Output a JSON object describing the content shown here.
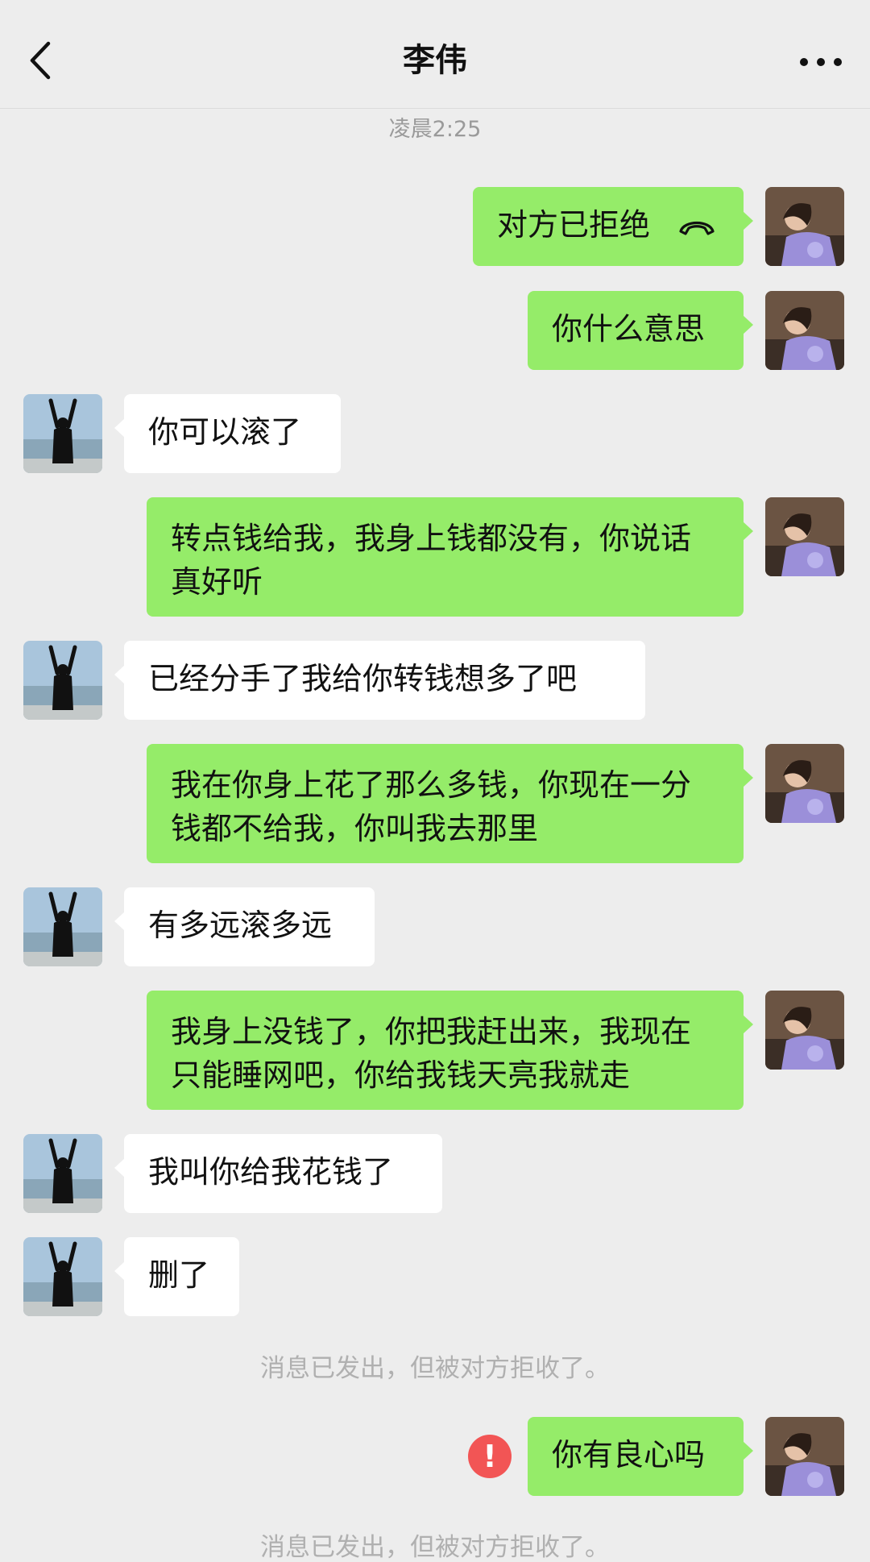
{
  "header": {
    "title": "李伟",
    "back_icon": "chevron-left-icon",
    "more_icon": "ellipsis-icon"
  },
  "chat": {
    "timestamp": "凌晨2:25",
    "messages": [
      {
        "from": "me",
        "text": "对方已拒绝",
        "icon": "phone-hangup-icon"
      },
      {
        "from": "me",
        "text": "你什么意思"
      },
      {
        "from": "other",
        "text": "你可以滚了"
      },
      {
        "from": "me",
        "text": "转点钱给我，我身上钱都没有，你说话真好听"
      },
      {
        "from": "other",
        "text": "已经分手了我给你转钱想多了吧"
      },
      {
        "from": "me",
        "text": "我在你身上花了那么多钱，你现在一分钱都不给我，你叫我去那里"
      },
      {
        "from": "other",
        "text": "有多远滚多远"
      },
      {
        "from": "me",
        "text": "我身上没钱了，你把我赶出来，我现在只能睡网吧，你给我钱天亮我就走"
      },
      {
        "from": "other",
        "text": "我叫你给我花钱了"
      },
      {
        "from": "other",
        "text": "删了"
      },
      {
        "from": "me",
        "text": "你有良心吗",
        "status": "failed",
        "status_icon": "exclamation-icon",
        "status_glyph": "!"
      }
    ],
    "system_notices": [
      "消息已发出，但被对方拒收了。",
      "消息已发出，但被对方拒收了。"
    ]
  },
  "colors": {
    "background": "#ededed",
    "my_bubble": "#95ec69",
    "other_bubble": "#ffffff",
    "error": "#f25555",
    "system_text": "#b0b0b0"
  }
}
